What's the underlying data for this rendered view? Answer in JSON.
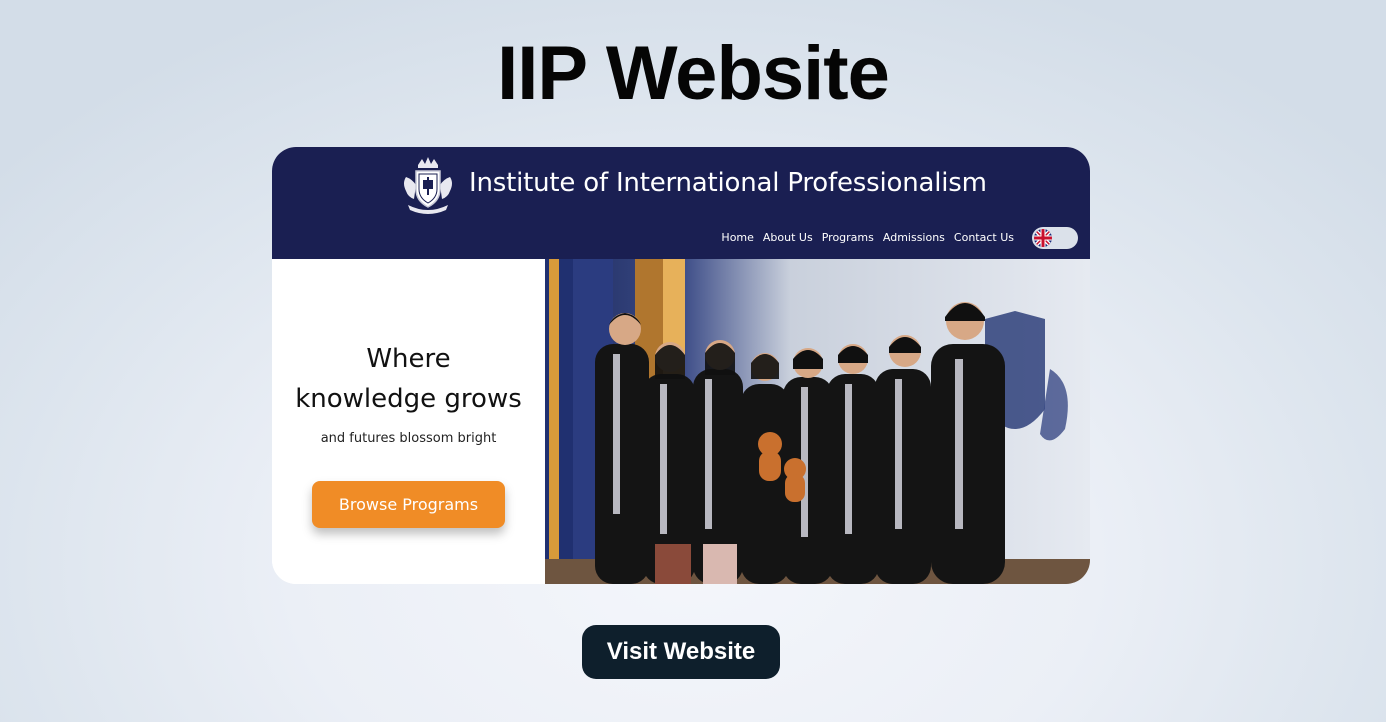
{
  "page": {
    "title": "IIP Website"
  },
  "preview": {
    "site_name": "Institute of International Professionalism",
    "nav": [
      "Home",
      "About Us",
      "Programs",
      "Admissions",
      "Contact Us"
    ],
    "language_flag": "uk-flag-icon",
    "hero": {
      "title_line1": "Where",
      "title_line2": "knowledge grows",
      "subtitle": "and futures blossom bright",
      "cta_label": "Browse Programs"
    },
    "photo": "graduation-group-photo",
    "colors": {
      "header": "#1a1f52",
      "cta": "#f08c26"
    }
  },
  "actions": {
    "visit_label": "Visit Website",
    "visit_color": "#0e1f2c"
  }
}
